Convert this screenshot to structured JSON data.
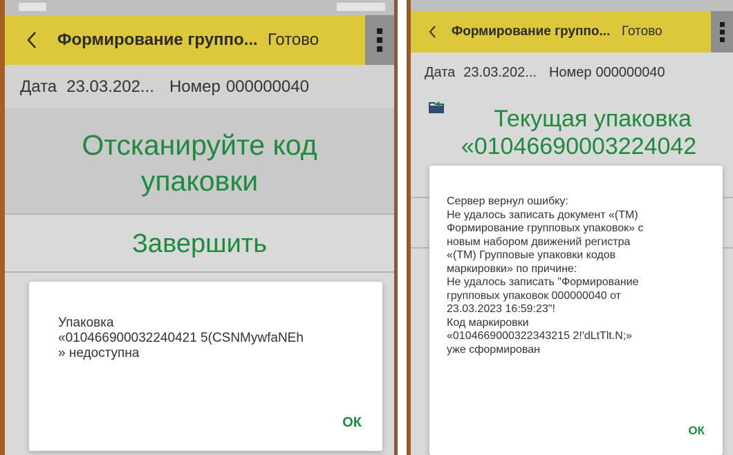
{
  "left": {
    "title": "Формирование группо...",
    "done_label": "Готово",
    "date_label": "Дата",
    "date_value": "23.03.202...",
    "number_label": "Номер",
    "number_value": "000000040",
    "scan_line1": "Отсканируйте код",
    "scan_line2": "упаковки",
    "finish_label": "Завершить",
    "dialog": {
      "message": "Упаковка\n«010466900032240421 5(CSNMywfaNEh\n» недоступна",
      "ok_label": "ОК"
    }
  },
  "right": {
    "title": "Формирование группо...",
    "done_label": "Готово",
    "date_label": "Дата",
    "date_value": "23.03.202...",
    "number_label": "Номер",
    "number_value": "000000040",
    "current_line1": "Текущая упаковка",
    "current_line2": "«01046690003224042",
    "dialog": {
      "message": "Сервер вернул ошибку:\nНе удалось записать документ «(ТМ)\nФормирование групповых упаковок» с\nновым набором движений регистра\n«(ТМ) Групповые упаковки кодов\nмаркировки» по причине:\nНе удалось записать \"Формирование\nгрупповых упаковок 000000040 от\n23.03.2023 16:59:23\"!\nКод маркировки\n«0104669000322343215 2!'dLtTlt.N;»\nуже сформирован",
      "ok_label": "ОК"
    }
  },
  "colors": {
    "appbar": "#dcc83a",
    "accent_green": "#1e8a3e",
    "menu_gray": "#8f8f8f"
  },
  "icons": {
    "back": "chevron-left-icon",
    "menu": "more-vertical-icon",
    "folder": "folder-upload-icon"
  }
}
